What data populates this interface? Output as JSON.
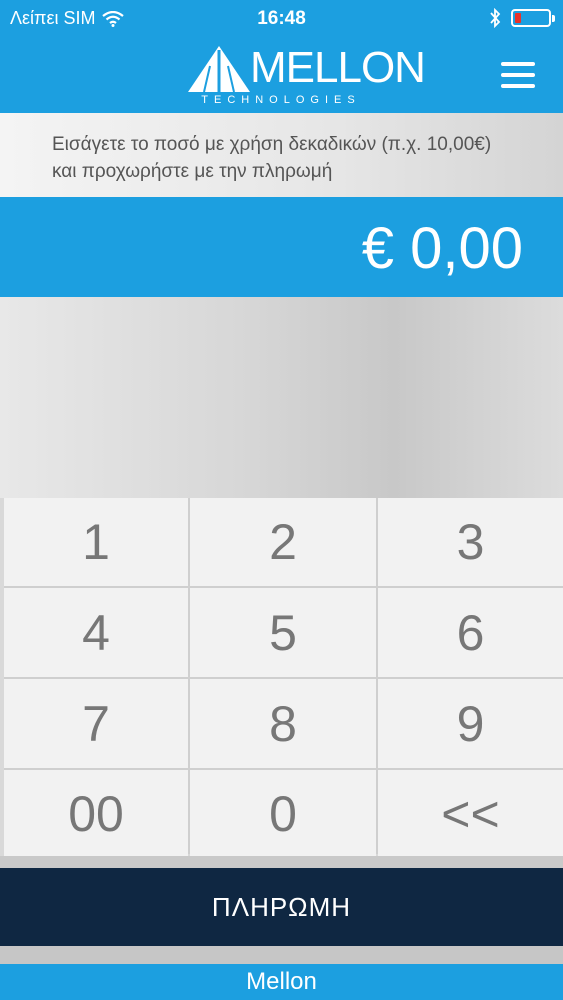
{
  "status_bar": {
    "carrier": "Λείπει SIM",
    "time": "16:48"
  },
  "logo": {
    "main": "MELLON",
    "sub": "TECHNOLOGIES"
  },
  "instructions": "Εισάγετε το ποσό με χρήση δεκαδικών (π.χ. 10,00€) και προχωρήστε με την πληρωμή",
  "amount": "€ 0,00",
  "keypad": {
    "k1": "1",
    "k2": "2",
    "k3": "3",
    "k4": "4",
    "k5": "5",
    "k6": "6",
    "k7": "7",
    "k8": "8",
    "k9": "9",
    "k00": "00",
    "k0": "0",
    "back": "<<"
  },
  "pay_button": "ΠΛΗΡΩΜΗ",
  "footer": "Mellon",
  "colors": {
    "primary_blue": "#1c9fe0",
    "pay_button_bg": "#0f2742",
    "battery_low": "#e8322a"
  }
}
